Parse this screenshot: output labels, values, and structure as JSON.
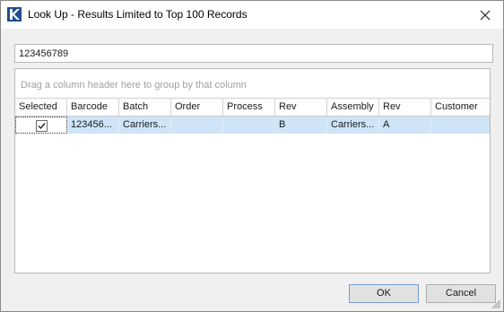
{
  "window": {
    "title": "Look Up - Results Limited to Top 100 Records"
  },
  "search": {
    "value": "123456789"
  },
  "grid": {
    "group_hint": "Drag a column header here to group by that column",
    "columns": [
      "Selected",
      "Barcode",
      "Batch",
      "Order",
      "Process",
      "Rev",
      "Assembly",
      "Rev",
      "Customer"
    ],
    "rows": [
      {
        "selected": true,
        "barcode": "123456...",
        "batch": "Carriers...",
        "order": "",
        "process": "",
        "rev": "B",
        "assembly": "Carriers...",
        "assembly_rev": "A",
        "customer": ""
      }
    ]
  },
  "buttons": {
    "ok": "OK",
    "cancel": "Cancel"
  },
  "colors": {
    "selected_row": "#cfe4f7",
    "app_icon": "#1f4e8c"
  },
  "icons": {
    "app": "app-logo-icon",
    "close": "close-icon",
    "check": "checkmark-icon",
    "grip": "resize-grip-icon"
  }
}
